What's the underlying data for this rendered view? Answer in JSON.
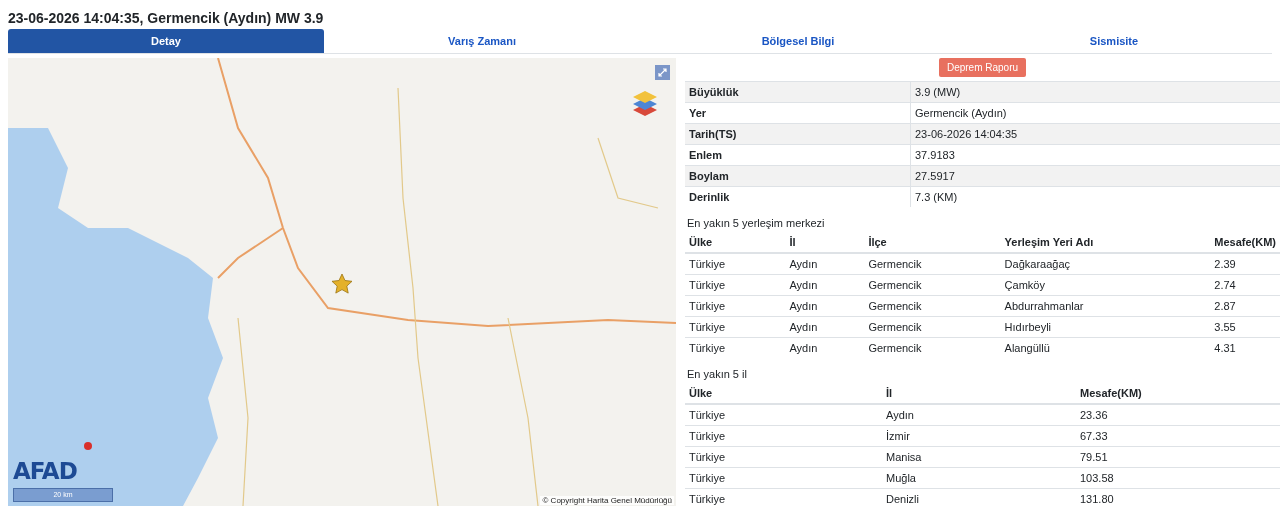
{
  "title": "23-06-2026 14:04:35, Germencik (Aydın) MW 3.9",
  "tabs": [
    {
      "label": "Detay",
      "selected": true
    },
    {
      "label": "Varış Zamanı",
      "selected": false
    },
    {
      "label": "Bölgesel Bilgi",
      "selected": false
    },
    {
      "label": "Sismisite",
      "selected": false
    }
  ],
  "map": {
    "logo": "AFAD",
    "scale": "20 km",
    "attribution": "© Copyright Harita Genel Müdürlüğü"
  },
  "report_button": "Deprem Raporu",
  "details": [
    {
      "label": "Büyüklük",
      "value": "3.9 (MW)"
    },
    {
      "label": "Yer",
      "value": "Germencik (Aydın)"
    },
    {
      "label": "Tarih(TS)",
      "value": "23-06-2026 14:04:35"
    },
    {
      "label": "Enlem",
      "value": "37.9183"
    },
    {
      "label": "Boylam",
      "value": "27.5917"
    },
    {
      "label": "Derinlik",
      "value": "7.3 (KM)"
    }
  ],
  "settlements": {
    "heading": "En yakın 5 yerleşim merkezi",
    "columns": [
      "Ülke",
      "İl",
      "İlçe",
      "Yerleşim Yeri Adı",
      "Mesafe(KM)"
    ],
    "rows": [
      [
        "Türkiye",
        "Aydın",
        "Germencik",
        "Dağkaraağaç",
        "2.39"
      ],
      [
        "Türkiye",
        "Aydın",
        "Germencik",
        "Çamköy",
        "2.74"
      ],
      [
        "Türkiye",
        "Aydın",
        "Germencik",
        "Abdurrahmanlar",
        "2.87"
      ],
      [
        "Türkiye",
        "Aydın",
        "Germencik",
        "Hıdırbeyli",
        "3.55"
      ],
      [
        "Türkiye",
        "Aydın",
        "Germencik",
        "Alangüllü",
        "4.31"
      ]
    ]
  },
  "provinces": {
    "heading": "En yakın 5 il",
    "columns": [
      "Ülke",
      "İl",
      "Mesafe(KM)"
    ],
    "rows": [
      [
        "Türkiye",
        "Aydın",
        "23.36"
      ],
      [
        "Türkiye",
        "İzmir",
        "67.33"
      ],
      [
        "Türkiye",
        "Manisa",
        "79.51"
      ],
      [
        "Türkiye",
        "Muğla",
        "103.58"
      ],
      [
        "Türkiye",
        "Denizli",
        "131.80"
      ]
    ]
  }
}
